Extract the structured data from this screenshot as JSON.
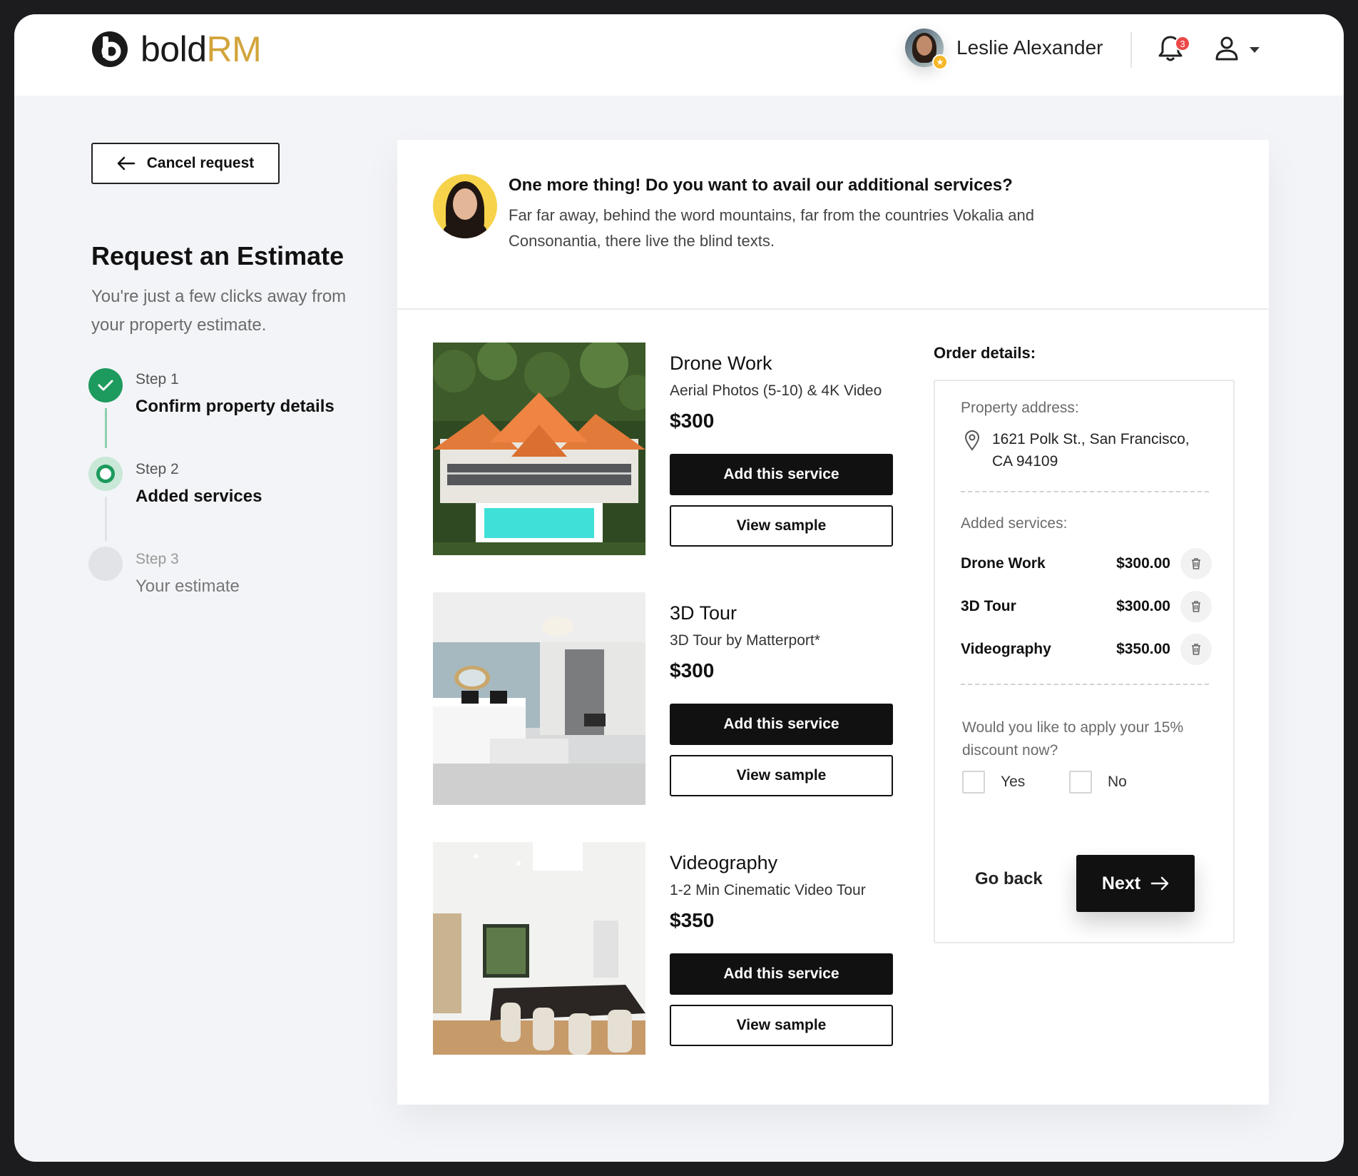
{
  "brand": {
    "logo_part1": "bold",
    "logo_part2": "RM",
    "accent_color": "#d2a43b"
  },
  "header": {
    "user_name": "Leslie Alexander",
    "notification_count": "3",
    "icons": [
      "star-icon",
      "bell-icon",
      "user-icon",
      "chevron-down-icon"
    ]
  },
  "sidebar": {
    "cancel_label": "Cancel request",
    "title": "Request an Estimate",
    "subtitle": "You're just a few clicks away from your property estimate.",
    "steps": [
      {
        "label": "Step 1",
        "title": "Confirm property details",
        "status": "complete"
      },
      {
        "label": "Step 2",
        "title": "Added services",
        "status": "current"
      },
      {
        "label": "Step 3",
        "title": "Your estimate",
        "status": "upcoming"
      }
    ],
    "success_color": "#1d9a5d"
  },
  "banner": {
    "title": "One more thing! Do you want to avail our additional services?",
    "text": "Far far away, behind the word mountains, far from the countries Vokalia and Consonantia, there live the blind texts."
  },
  "services": [
    {
      "name": "Drone Work",
      "desc": "Aerial Photos (5-10) & 4K Video",
      "price": "$300",
      "add_label": "Add this service",
      "sample_label": "View sample"
    },
    {
      "name": "3D Tour",
      "desc": "3D Tour by Matterport*",
      "price": "$300",
      "add_label": "Add this service",
      "sample_label": "View sample"
    },
    {
      "name": "Videography",
      "desc": "1-2 Min Cinematic Video Tour",
      "price": "$350",
      "add_label": "Add this service",
      "sample_label": "View sample"
    }
  ],
  "order": {
    "title": "Order details:",
    "address_label": "Property address:",
    "address": "1621 Polk St., San Francisco, CA 94109",
    "services_label": "Added services:",
    "items": [
      {
        "name": "Drone Work",
        "price": "$300.00"
      },
      {
        "name": "3D Tour",
        "price": "$300.00"
      },
      {
        "name": "Videography",
        "price": "$350.00"
      }
    ],
    "discount_question": "Would you like to apply your 15% discount now?",
    "yes_label": "Yes",
    "no_label": "No",
    "go_back_label": "Go back",
    "next_label": "Next"
  }
}
